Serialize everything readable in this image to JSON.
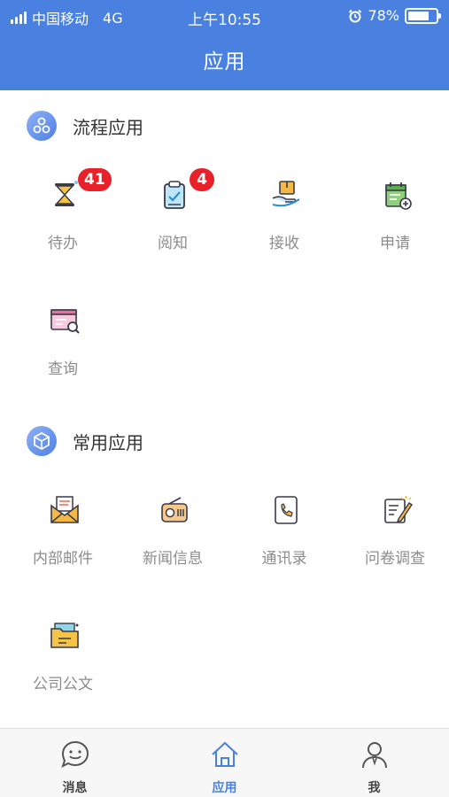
{
  "status_bar": {
    "carrier": "中国移动",
    "network": "4G",
    "time": "上午10:55",
    "battery": "78%",
    "battery_level": 0.78
  },
  "header": {
    "title": "应用"
  },
  "sections": [
    {
      "title": "流程应用",
      "icon": "flow-circles-icon",
      "items": [
        {
          "label": "待办",
          "icon": "hourglass-icon",
          "badge": "41"
        },
        {
          "label": "阅知",
          "icon": "clipboard-check-icon",
          "badge": "4"
        },
        {
          "label": "接收",
          "icon": "hand-box-icon"
        },
        {
          "label": "申请",
          "icon": "calendar-add-icon"
        },
        {
          "label": "查询",
          "icon": "search-card-icon"
        }
      ]
    },
    {
      "title": "常用应用",
      "icon": "cube-icon",
      "items": [
        {
          "label": "内部邮件",
          "icon": "mail-icon"
        },
        {
          "label": "新闻信息",
          "icon": "radio-icon"
        },
        {
          "label": "通讯录",
          "icon": "phone-book-icon"
        },
        {
          "label": "问卷调查",
          "icon": "survey-pencil-icon"
        },
        {
          "label": "公司公文",
          "icon": "folder-document-icon"
        }
      ]
    }
  ],
  "tabs": [
    {
      "label": "消息",
      "icon": "chat-smile-icon",
      "active": false
    },
    {
      "label": "应用",
      "icon": "apps-house-icon",
      "active": true
    },
    {
      "label": "我",
      "icon": "user-profile-icon",
      "active": false
    }
  ],
  "colors": {
    "primary": "#4a80e0",
    "badge": "#e8202a",
    "label_gray": "#8c8c8c"
  }
}
